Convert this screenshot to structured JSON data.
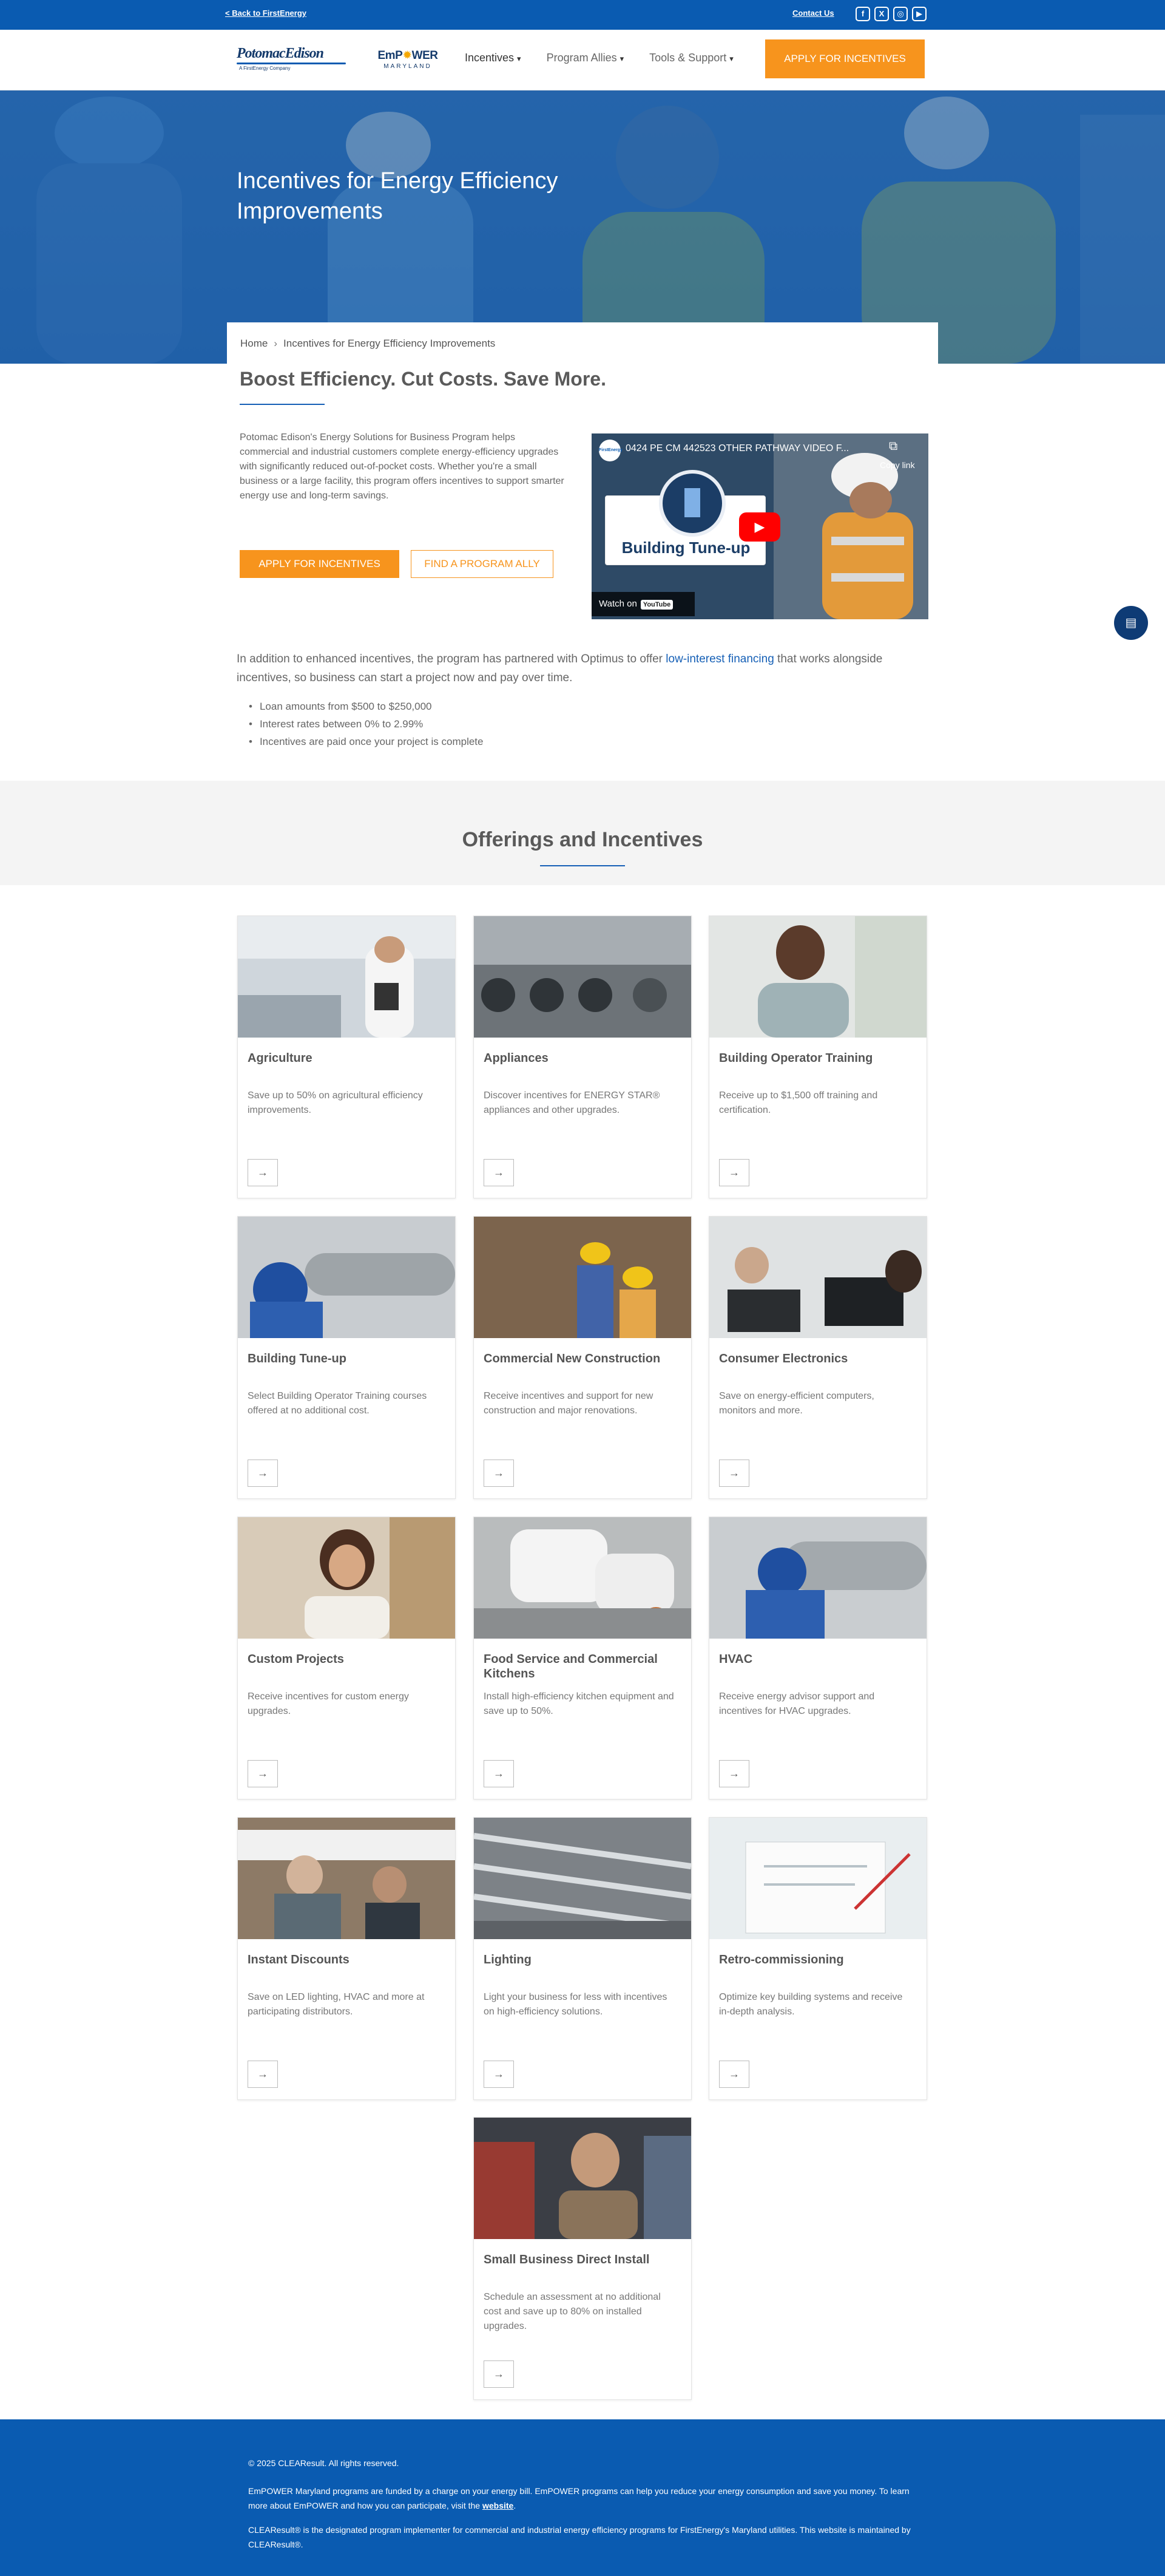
{
  "topbar": {
    "back_link": "< Back to FirstEnergy",
    "contact_link": "Contact Us",
    "social": [
      {
        "icon": "facebook-icon",
        "glyph": "f"
      },
      {
        "icon": "x-icon",
        "glyph": "X"
      },
      {
        "icon": "instagram-icon",
        "glyph": "◎"
      },
      {
        "icon": "youtube-icon",
        "glyph": "▶"
      }
    ]
  },
  "header": {
    "logo_pe_name": "PotomacEdison",
    "logo_pe_sub": "A FirstEnergy Company",
    "logo_em_a": "EmP",
    "logo_em_star": "✹",
    "logo_em_b": "WER",
    "logo_em_sub": "MARYLAND",
    "nav": [
      {
        "label": "Incentives",
        "caret": "▾"
      },
      {
        "label": "Program Allies",
        "caret": "▾"
      },
      {
        "label": "Tools & Support",
        "caret": "▾"
      }
    ],
    "apply_label": "APPLY FOR INCENTIVES"
  },
  "hero": {
    "title": "Incentives for Energy Efficiency Improvements"
  },
  "breadcrumb": {
    "home": "Home",
    "separator": "›",
    "current": "Incentives for Energy Efficiency Improvements"
  },
  "intro": {
    "heading": "Boost Efficiency. Cut Costs. Save More.",
    "paragraph": "Potomac Edison's Energy Solutions for Business Program helps commercial and industrial customers complete energy-efficiency upgrades with significantly reduced out-of-pocket costs. Whether you're a small business or a large facility, this program offers incentives to support smarter energy use and long-term savings.",
    "apply_button": "APPLY FOR INCENTIVES",
    "ally_button": "FIND A PROGRAM ALLY"
  },
  "video": {
    "channel_label": "FirstEnergy",
    "title": "0424 PE CM 442523 OTHER PATHWAY VIDEO F...",
    "copy_label": "Copy link",
    "card_title": "Building Tune-up",
    "watch_label": "Watch on",
    "watch_brand": "YouTube"
  },
  "partner": {
    "text_before": "In addition to enhanced incentives, the program has partnered with Optimus to offer ",
    "link": "low-interest financing",
    "text_after": " that works alongside incentives, so business can start a project now and pay over time.",
    "bullets": [
      "Loan amounts from $500 to $250,000",
      "Interest rates between 0% to 2.99%",
      "Incentives are paid once your project is complete"
    ]
  },
  "offerings": {
    "heading": "Offerings and Incentives",
    "arrow_glyph": "→",
    "cards": [
      {
        "title": "Agriculture",
        "desc": "Save up to 50% on agricultural efficiency improvements."
      },
      {
        "title": "Appliances",
        "desc": "Discover incentives for ENERGY STAR® appliances and other upgrades."
      },
      {
        "title": "Building Operator Training",
        "desc": "Receive up to $1,500 off training and certification."
      },
      {
        "title": "Building Tune-up",
        "desc": "Select Building Operator Training courses offered at no additional cost."
      },
      {
        "title": "Commercial New Construction",
        "desc": "Receive incentives and support for new construction and major renovations."
      },
      {
        "title": "Consumer Electronics",
        "desc": "Save on energy-efficient computers, monitors and more."
      },
      {
        "title": "Custom Projects",
        "desc": "Receive incentives for custom energy upgrades."
      },
      {
        "title": "Food Service and Commercial Kitchens",
        "desc": "Install high-efficiency kitchen equipment and save up to 50%."
      },
      {
        "title": "HVAC",
        "desc": "Receive energy advisor support and incentives for HVAC upgrades."
      },
      {
        "title": "Instant Discounts",
        "desc": "Save on LED lighting, HVAC and more at participating distributors."
      },
      {
        "title": "Lighting",
        "desc": "Light your business for less with incentives on high-efficiency solutions."
      },
      {
        "title": "Retro-commissioning",
        "desc": "Optimize key building systems and receive in-depth analysis."
      },
      {
        "title": "Small Business Direct Install",
        "desc": "Schedule an assessment at no additional cost and save up to 80% on installed upgrades."
      }
    ]
  },
  "footer": {
    "copyright": "© 2025 CLEAResult. All rights reserved.",
    "funding_text": "EmPOWER Maryland programs are funded by a charge on your energy bill. EmPOWER programs can help you reduce your energy consumption and save you money. To learn more about EmPOWER and how you can participate, visit the ",
    "funding_link": "website",
    "funding_end": ".",
    "implementer": "CLEAResult® is the designated program implementer for commercial and industrial energy efficiency programs for FirstEnergy's Maryland utilities. This website is maintained by CLEAResult®."
  },
  "colors": {
    "brand_blue": "#0a5bb1",
    "accent_orange": "#f7941d",
    "link_blue": "#1660b6"
  }
}
